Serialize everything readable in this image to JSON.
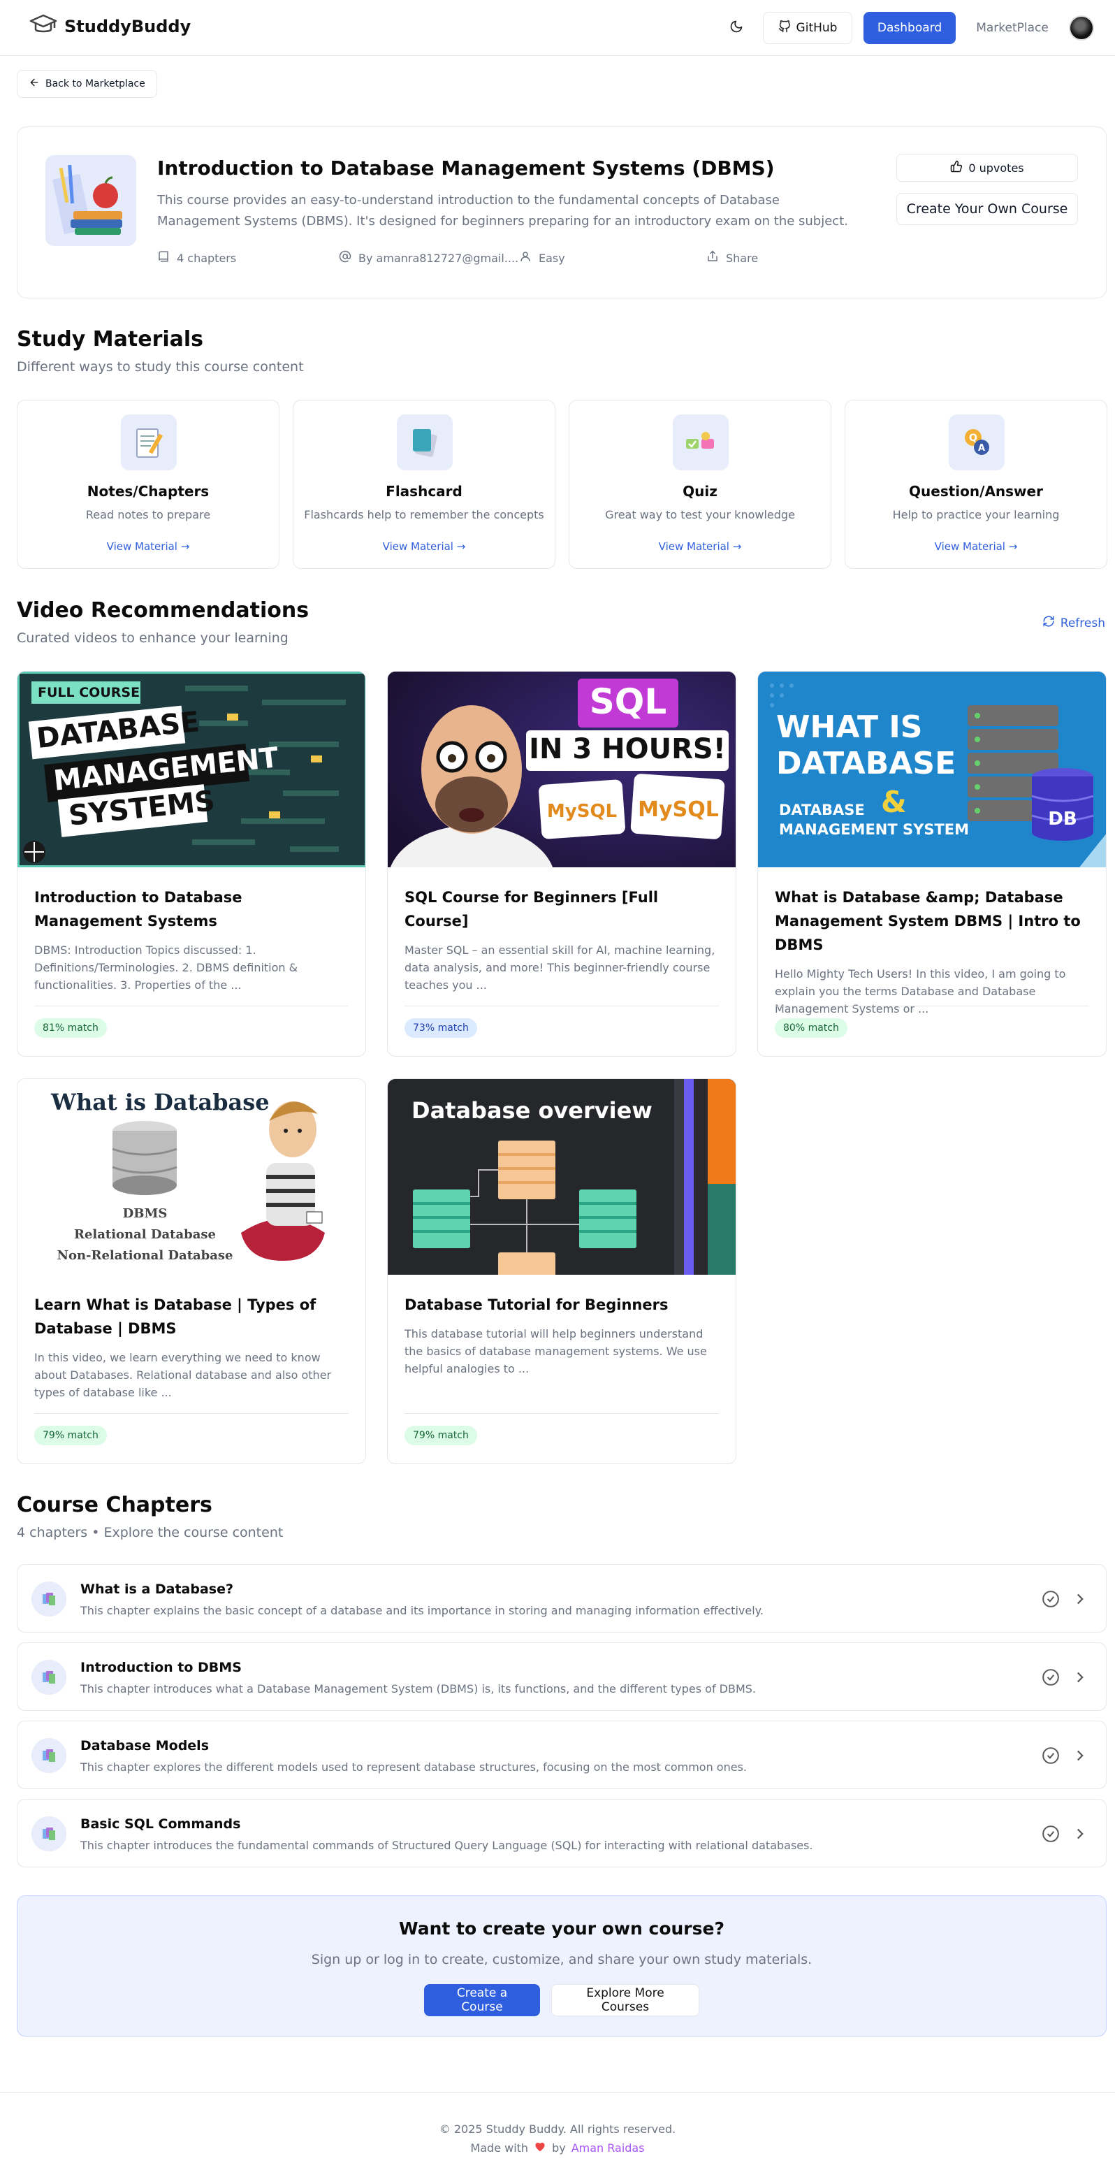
{
  "header": {
    "brand": "StuddyBuddy",
    "github": "GitHub",
    "dashboard": "Dashboard",
    "marketplace": "MarketPlace"
  },
  "back": "Back to Marketplace",
  "course": {
    "title": "Introduction to Database Management Systems (DBMS)",
    "description": "This course provides an easy-to-understand introduction to the fundamental concepts of Database Management Systems (DBMS). It's designed for beginners preparing for an introductory exam on the subject.",
    "chapters": "4 chapters",
    "author": "By amanra812727@gmail....",
    "difficulty": "Easy",
    "share": "Share",
    "upvotes": "0 upvotes",
    "create_own": "Create Your Own Course"
  },
  "study_materials": {
    "title": "Study Materials",
    "subtitle": "Different ways to study this course content",
    "items": [
      {
        "title": "Notes/Chapters",
        "desc": "Read notes to prepare",
        "link": "View Material →"
      },
      {
        "title": "Flashcard",
        "desc": "Flashcards help to remember the concepts",
        "link": "View Material →"
      },
      {
        "title": "Quiz",
        "desc": "Great way to test your knowledge",
        "link": "View Material →"
      },
      {
        "title": "Question/Answer",
        "desc": "Help to practice your learning",
        "link": "View Material →"
      }
    ]
  },
  "videos": {
    "title": "Video Recommendations",
    "subtitle": "Curated videos to enhance your learning",
    "refresh": "Refresh",
    "items": [
      {
        "title": "Introduction to Database Management Systems",
        "desc": "DBMS: Introduction Topics discussed: 1. Definitions/Terminologies. 2. DBMS definition & functionalities. 3. Properties of the ...",
        "match": "81% match",
        "thumb": {
          "tag": "FULL COURSE",
          "l1": "DATABASE",
          "l2": "MANAGEMENT",
          "l3": "SYSTEMS"
        }
      },
      {
        "title": "SQL Course for Beginners [Full Course]",
        "desc": "Master SQL – an essential skill for AI, machine learning, data analysis, and more! This beginner-friendly course teaches you ...",
        "match": "73% match",
        "thumb": {
          "l1": "SQL",
          "l2": "IN 3 HOURS!",
          "logo": "MySQL"
        }
      },
      {
        "title": "What is Database &amp; Database Management System DBMS | Intro to DBMS",
        "desc": "Hello Mighty Tech Users! In this video, I am going to explain you the terms Database and Database Management Systems or ...",
        "match": "80% match",
        "thumb": {
          "l1": "WHAT IS",
          "l2": "DATABASE",
          "l3": "DATABASE",
          "amp": "&",
          "l4": "MANAGEMENT SYSTEM",
          "db": "DB"
        }
      },
      {
        "title": "Learn What is Database | Types of Database | DBMS",
        "desc": "In this video, we learn everything we need to know about Databases. Relational database and also other types of database like ...",
        "match": "79% match",
        "thumb": {
          "l1": "What is Database",
          "l2": "DBMS",
          "l3": "Relational Database",
          "l4": "Non-Relational Database"
        }
      },
      {
        "title": "Database Tutorial for Beginners",
        "desc": "This database tutorial will help beginners understand the basics of database management systems. We use helpful analogies to ...",
        "match": "79% match",
        "thumb": {
          "l1": "Database overview"
        }
      }
    ]
  },
  "chapters": {
    "title": "Course Chapters",
    "subtitle": "4 chapters • Explore the course content",
    "items": [
      {
        "title": "What is a Database?",
        "desc": "This chapter explains the basic concept of a database and its importance in storing and managing information effectively."
      },
      {
        "title": "Introduction to DBMS",
        "desc": "This chapter introduces what a Database Management System (DBMS) is, its functions, and the different types of DBMS."
      },
      {
        "title": "Database Models",
        "desc": "This chapter explores the different models used to represent database structures, focusing on the most common ones."
      },
      {
        "title": "Basic SQL Commands",
        "desc": "This chapter introduces the fundamental commands of Structured Query Language (SQL) for interacting with relational databases."
      }
    ]
  },
  "cta": {
    "title": "Want to create your own course?",
    "subtitle": "Sign up or log in to create, customize, and share your own study materials.",
    "create": "Create a Course",
    "explore": "Explore More Courses"
  },
  "footer": {
    "copyright": "© 2025 Studdy Buddy. All rights reserved.",
    "made_with": "Made with",
    "by": "by",
    "author": "Aman Raidas"
  },
  "colors": {
    "accent": "#2f5fde",
    "heart": "#ef4444",
    "author": "#a855f7"
  }
}
